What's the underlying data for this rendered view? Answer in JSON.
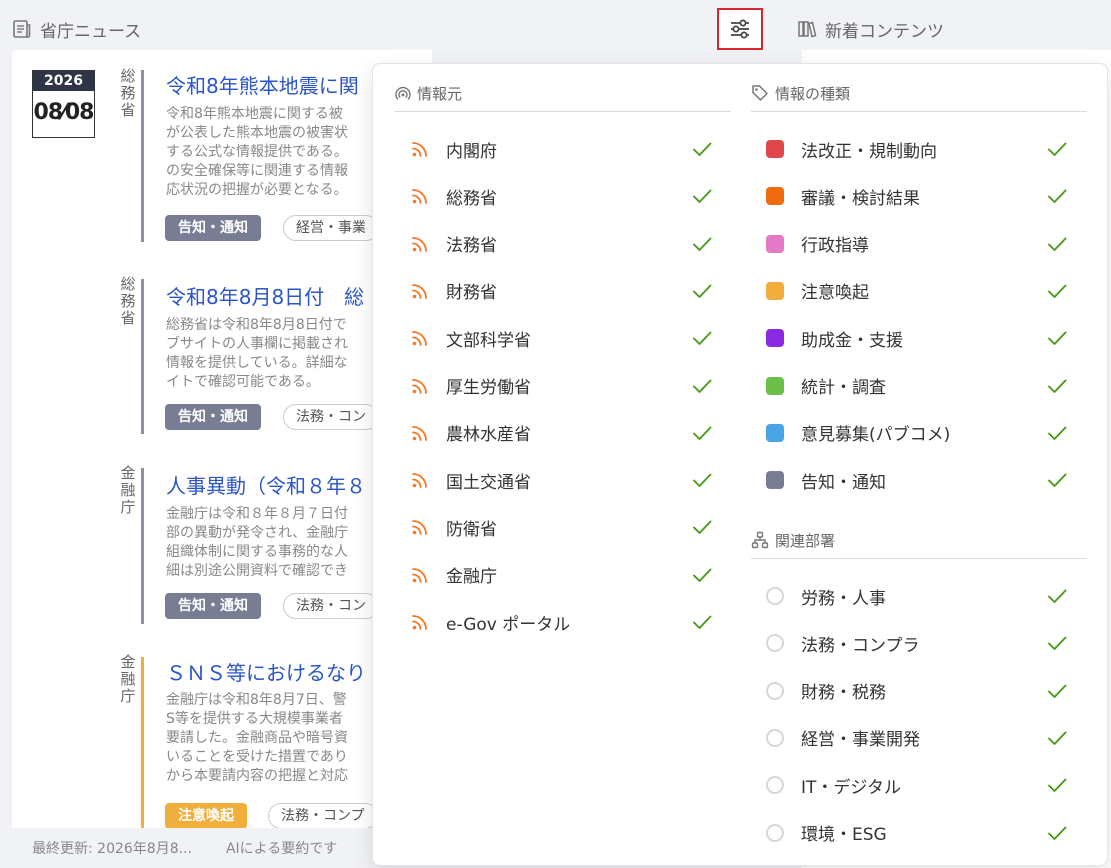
{
  "header": {
    "news_title": "省庁ニュース",
    "contents_title": "新着コンテンツ"
  },
  "news": [
    {
      "year": "2026",
      "month_day": "08⁄08",
      "ministry": "総務省",
      "bar_color": "#8a8fa5",
      "title": "令和8年熊本地震に関",
      "summary": "令和8年熊本地震に関する被\nが公表した熊本地震の被害状\nする公式な情報提供である。\nの安全確保等に関連する情報\n応状況の把握が必要となる。",
      "tag": "告知・通知",
      "tag_type": "notice",
      "dept": "経営・事業"
    },
    {
      "year": "",
      "month_day": "",
      "ministry": "総務省",
      "bar_color": "#8a8fa5",
      "title": "令和8年8月8日付　総",
      "summary": "総務省は令和8年8月8日付で\nブサイトの人事欄に掲載され\n情報を提供している。詳細な\nイトで確認可能である。",
      "tag": "告知・通知",
      "tag_type": "notice",
      "dept": "法務・コン"
    },
    {
      "year": "",
      "month_day": "",
      "ministry": "金融庁",
      "bar_color": "#8a8fa5",
      "title": "人事異動（令和８年８",
      "summary": "金融庁は令和８年８月７日付\n部の異動が発令され、金融庁\n組織体制に関する事務的な人\n細は別途公開資料で確認でき",
      "tag": "告知・通知",
      "tag_type": "notice",
      "dept": "法務・コン"
    },
    {
      "year": "",
      "month_day": "",
      "ministry": "金融庁",
      "bar_color": "#f2ae3c",
      "title": "ＳＮＳ等におけるなり",
      "summary": "金融庁は令和8年8月7日、警\nS等を提供する大規模事業者\n要請した。金融商品や暗号資\nいることを受けた措置であり\nから本要請内容の把握と対応",
      "tag": "注意喚起",
      "tag_type": "caution",
      "dept": "法務・コンプ"
    }
  ],
  "footer": {
    "last_updated": "最終更新: 2026年8月8...",
    "ai_note": "AIによる要約です"
  },
  "filter": {
    "sources_title": "情報元",
    "sources": [
      "内閣府",
      "総務省",
      "法務省",
      "財務省",
      "文部科学省",
      "厚生労働省",
      "農林水産省",
      "国土交通省",
      "防衛省",
      "金融庁",
      "e-Gov ポータル"
    ],
    "types_title": "情報の種類",
    "types": [
      {
        "label": "法改正・規制動向",
        "color": "#e0474c"
      },
      {
        "label": "審議・検討結果",
        "color": "#f06a0f"
      },
      {
        "label": "行政指導",
        "color": "#e479c8"
      },
      {
        "label": "注意喚起",
        "color": "#f2ae3c"
      },
      {
        "label": "助成金・支援",
        "color": "#8a2be2"
      },
      {
        "label": "統計・調査",
        "color": "#6cc04a"
      },
      {
        "label": "意見募集(パブコメ)",
        "color": "#4aa5e6"
      },
      {
        "label": "告知・通知",
        "color": "#787d94"
      }
    ],
    "depts_title": "関連部署",
    "depts": [
      "労務・人事",
      "法務・コンプラ",
      "財務・税務",
      "経営・事業開発",
      "IT・デジタル",
      "環境・ESG"
    ]
  },
  "colors": {
    "rss": "#f07a2a",
    "check": "#4a9a1a",
    "link": "#2b56c8",
    "highlight": "#d9252e"
  }
}
